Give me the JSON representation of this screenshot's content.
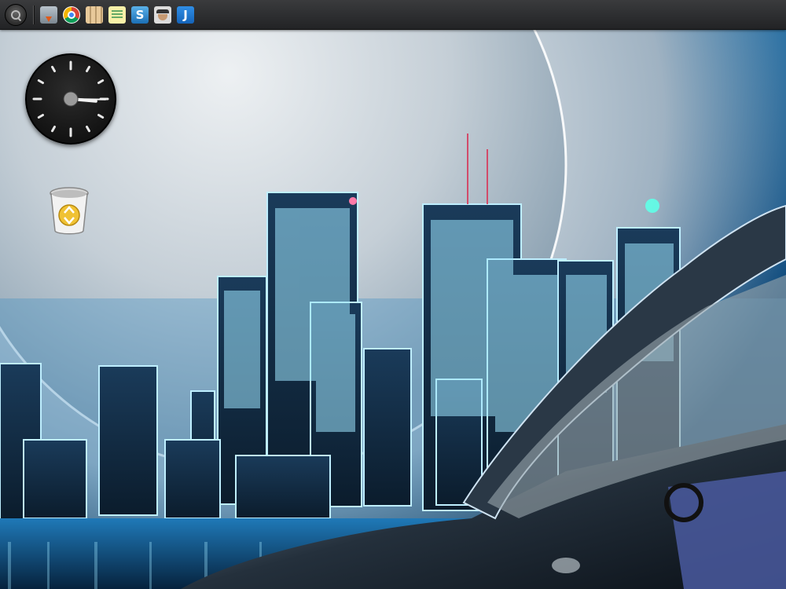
{
  "panel": {
    "menu_icon": "menu-icon",
    "launchers": [
      {
        "name": "software-installer-icon"
      },
      {
        "name": "chrome-browser-icon"
      },
      {
        "name": "map-icon"
      },
      {
        "name": "notes-icon"
      },
      {
        "name": "sync-icon"
      },
      {
        "name": "spy-avatar-icon"
      },
      {
        "name": "j-app-icon",
        "label": "J"
      }
    ],
    "sync_glyph": "S"
  },
  "desktop": {
    "clock": {
      "hour_hand_deg": 95,
      "minute_hand_deg": 91
    },
    "trash_icon": "trash-icon"
  },
  "colors": {
    "panel_bg": "#2b2c2e",
    "sky": "#1a6aa3",
    "neon": "#9fe6ff",
    "moon": "#d9dfe4"
  }
}
